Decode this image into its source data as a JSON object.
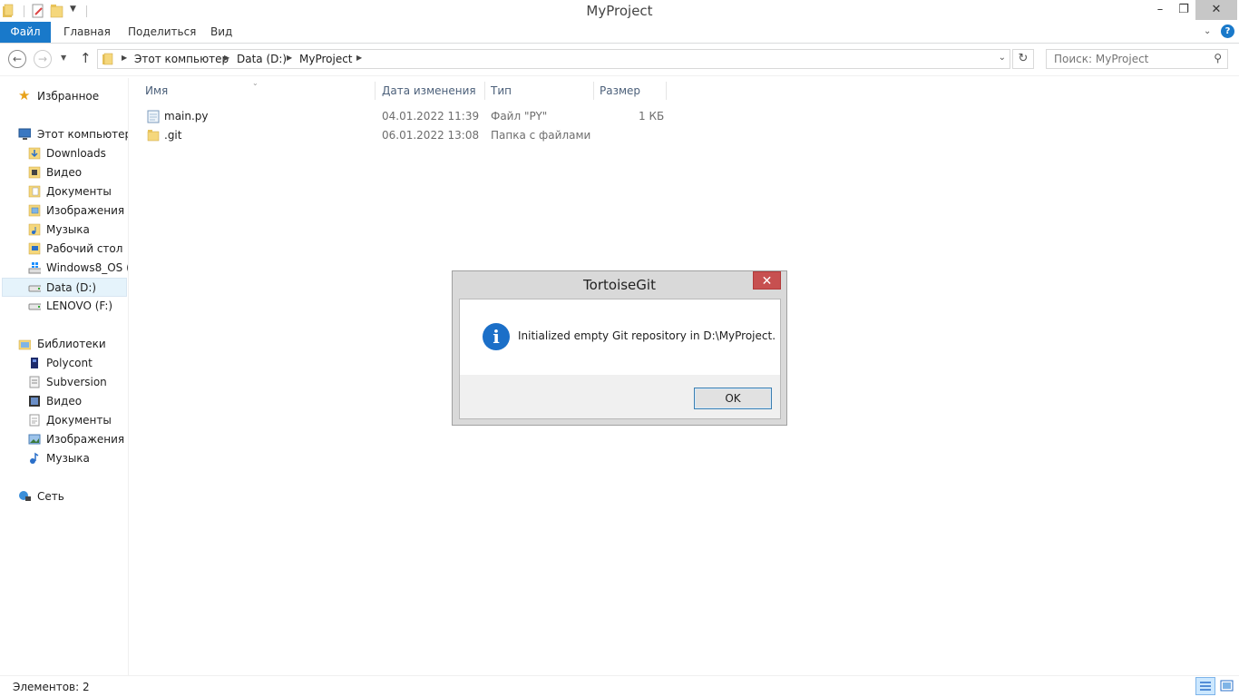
{
  "window": {
    "title": "MyProject"
  },
  "ribbon": {
    "tabs": [
      "Файл",
      "Главная",
      "Поделиться",
      "Вид"
    ]
  },
  "address": {
    "segments": [
      "Этот компьютер",
      "Data (D:)",
      "MyProject"
    ]
  },
  "search": {
    "placeholder": "Поиск: MyProject"
  },
  "navpane": {
    "favorites": "Избранное",
    "this_pc": "Этот компьютер",
    "pc_items": [
      "Downloads",
      "Видео",
      "Документы",
      "Изображения",
      "Музыка",
      "Рабочий стол",
      "Windows8_OS (C",
      "Data (D:)",
      "LENOVO (F:)"
    ],
    "libraries": "Библиотеки",
    "library_items": [
      "Polycont",
      "Subversion",
      "Видео",
      "Документы",
      "Изображения",
      "Музыка"
    ],
    "network": "Сеть"
  },
  "columns": {
    "name": "Имя",
    "date": "Дата изменения",
    "type": "Тип",
    "size": "Размер"
  },
  "files": [
    {
      "name": "main.py",
      "date": "04.01.2022 11:39",
      "type": "Файл \"PY\"",
      "size": "1 КБ",
      "icon": "py-file-icon"
    },
    {
      "name": ".git",
      "date": "06.01.2022 13:08",
      "type": "Папка с файлами",
      "size": "",
      "icon": "folder-icon"
    }
  ],
  "status": {
    "items_count": "Элементов: 2"
  },
  "dialog": {
    "title": "TortoiseGit",
    "message": "Initialized empty Git repository in D:\\MyProject.",
    "ok_label": "OK"
  },
  "colors": {
    "accent": "#1979ca",
    "dialog_close": "#c75050",
    "info_icon": "#1b6fc8",
    "selection": "#e5f3fb"
  }
}
